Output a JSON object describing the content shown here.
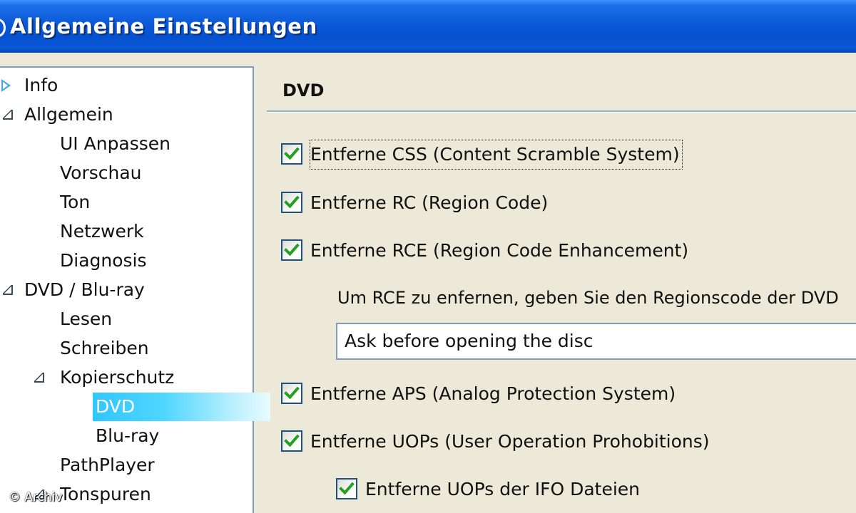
{
  "window": {
    "title": "Allgemeine Einstellungen"
  },
  "tree": {
    "items": [
      {
        "label": "Info",
        "level": 0,
        "expander": "collapsed"
      },
      {
        "label": "Allgemein",
        "level": 0,
        "expander": "expanded"
      },
      {
        "label": "UI Anpassen",
        "level": 1,
        "expander": "none"
      },
      {
        "label": "Vorschau",
        "level": 1,
        "expander": "none"
      },
      {
        "label": "Ton",
        "level": 1,
        "expander": "none"
      },
      {
        "label": "Netzwerk",
        "level": 1,
        "expander": "none"
      },
      {
        "label": "Diagnosis",
        "level": 1,
        "expander": "none"
      },
      {
        "label": "DVD / Blu-ray",
        "level": 0,
        "expander": "expanded"
      },
      {
        "label": "Lesen",
        "level": 1,
        "expander": "none"
      },
      {
        "label": "Schreiben",
        "level": 1,
        "expander": "none"
      },
      {
        "label": "Kopierschutz",
        "level": 1,
        "expander": "expanded"
      },
      {
        "label": "DVD",
        "level": 2,
        "expander": "none",
        "selected": true
      },
      {
        "label": "Blu-ray",
        "level": 2,
        "expander": "none"
      },
      {
        "label": "PathPlayer",
        "level": 1,
        "expander": "none"
      },
      {
        "label": "Tonspuren",
        "level": 1,
        "expander": "expanded"
      }
    ]
  },
  "panel": {
    "title": "DVD",
    "options": [
      {
        "label": "Entferne CSS (Content Scramble System)",
        "checked": true,
        "focused": true
      },
      {
        "label": "Entferne RC (Region Code)",
        "checked": true
      },
      {
        "label": "Entferne RCE (Region Code Enhancement)",
        "checked": true
      },
      {
        "label": "Entferne APS (Analog Protection System)",
        "checked": true
      },
      {
        "label": "Entferne UOPs (User Operation Prohobitions)",
        "checked": true
      },
      {
        "label": "Entferne UOPs der IFO Dateien",
        "checked": true
      }
    ],
    "rce_hint": "Um RCE zu enfernen, geben Sie den Regionscode der DVD",
    "region_select": {
      "value": "Ask before opening the disc"
    }
  },
  "watermark": "© Archiv",
  "colors": {
    "titlebar": "#0a5ad9",
    "selection": "#31c6ff",
    "checkmark": "#21a121",
    "window_bg": "#ece9d8"
  }
}
